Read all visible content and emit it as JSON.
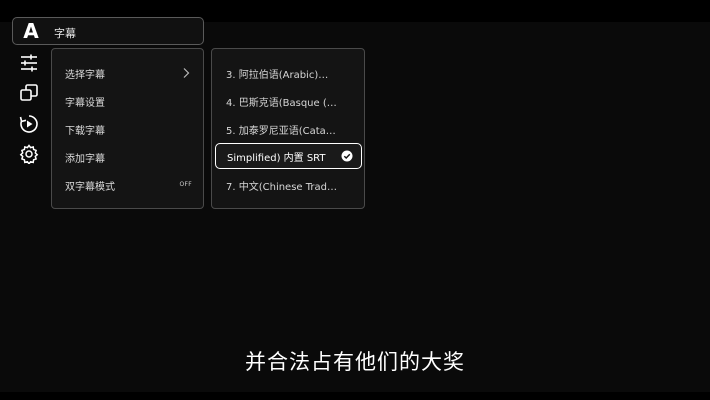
{
  "header": {
    "logo_letter": "A",
    "title": "字幕"
  },
  "rail": {
    "icons": [
      "sliders-icon",
      "windows-icon",
      "replay-speed-icon",
      "gear-icon"
    ]
  },
  "menu": {
    "items": [
      {
        "label": "选择字幕",
        "has_submenu": true
      },
      {
        "label": "字幕设置"
      },
      {
        "label": "下载字幕"
      },
      {
        "label": "添加字幕"
      },
      {
        "label": "双字幕模式",
        "badge": "OFF"
      }
    ]
  },
  "submenu": {
    "items": [
      {
        "label": "3. 阿拉伯语(Arabic)…"
      },
      {
        "label": "4. 巴斯克语(Basque (…"
      },
      {
        "label": "5. 加泰罗尼亚语(Cata…"
      },
      {
        "label": "Simplified)  内置 SRT",
        "selected": true
      },
      {
        "label": "7. 中文(Chinese Trad…"
      }
    ]
  },
  "subtitle_text": "并合法占有他们的大奖",
  "colors": {
    "background": "#000000",
    "panel": "#141414",
    "border": "#4a4a4a",
    "selected_border": "#ffffff",
    "text": "#ffffff"
  }
}
